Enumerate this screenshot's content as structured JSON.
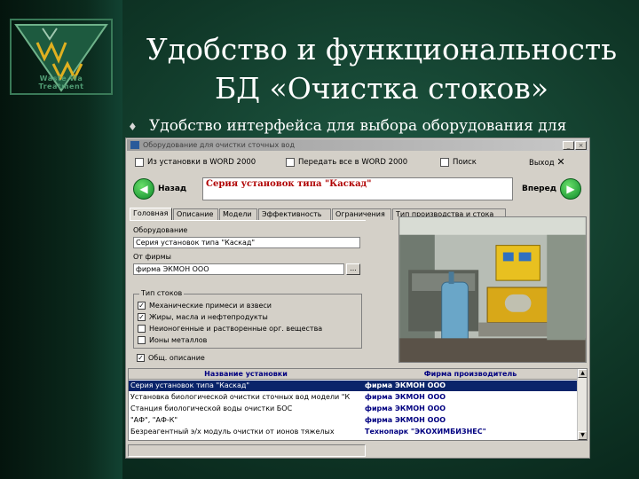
{
  "slide": {
    "title_line1": "Удобство и функциональность",
    "title_line2": "БД «Очистка стоков»",
    "bullet": "Удобство интерфейса для выбора оборудования для",
    "logo_text_1": "Waste Wa",
    "logo_text_2": "Treatment"
  },
  "colors": {
    "background": "#103828",
    "selection": "#0a246a",
    "series_text": "#b00000",
    "company_text": "#000080"
  },
  "window": {
    "title": "Оборудование для очистки сточных вод",
    "menu": [
      "Из установки в WORD 2000",
      "Передать все в WORD 2000",
      "Поиск",
      "Выход"
    ],
    "nav": {
      "back": "Назад",
      "forward": "Вперед",
      "series_text": "Серия установок типа \"Каскад\""
    },
    "tabs": [
      "Головная",
      "Описание",
      "Модели",
      "Эффективность",
      "Ограничения",
      "Тип производства и стока"
    ],
    "form": {
      "equipment_label": "Оборудование",
      "equipment_value": "Серия установок типа \"Каскад\"",
      "company_label": "От фирмы",
      "company_value": "фирма ЭКМОН ООО",
      "dots_button": "...",
      "group_title": "Тип стоков",
      "checkboxes": [
        {
          "label": "Механические примеси и взвеси",
          "checked": true
        },
        {
          "label": "Жиры, масла и нефтепродукты",
          "checked": true
        },
        {
          "label": "Неионогенные и растворенные орг. вещества",
          "checked": false
        },
        {
          "label": "Ионы металлов",
          "checked": false
        }
      ],
      "general_check": {
        "label": "Общ. описание",
        "checked": true
      }
    },
    "grid": {
      "headers": [
        "Название установки",
        "Фирма производитель"
      ],
      "rows": [
        {
          "name": "Серия установок типа \"Каскад\"",
          "company": "фирма ЭКМОН ООО",
          "selected": true
        },
        {
          "name": "Установка биологической очистки сточных вод модели \"К",
          "company": "фирма ЭКМОН ООО",
          "selected": false
        },
        {
          "name": "Станция биологической воды очистки БОС",
          "company": "фирма ЭКМОН ООО",
          "selected": false
        },
        {
          "name": "\"АФ\", \"АФ-К\"",
          "company": "фирма ЭКМОН ООО",
          "selected": false
        },
        {
          "name": "Безреагентный э/х модуль очистки от ионов тяжелых",
          "company": "Технопарк \"ЭКОХИМБИЗНЕС\"",
          "selected": false
        }
      ]
    },
    "buttons": {
      "minimize": "_",
      "close": "×"
    }
  }
}
